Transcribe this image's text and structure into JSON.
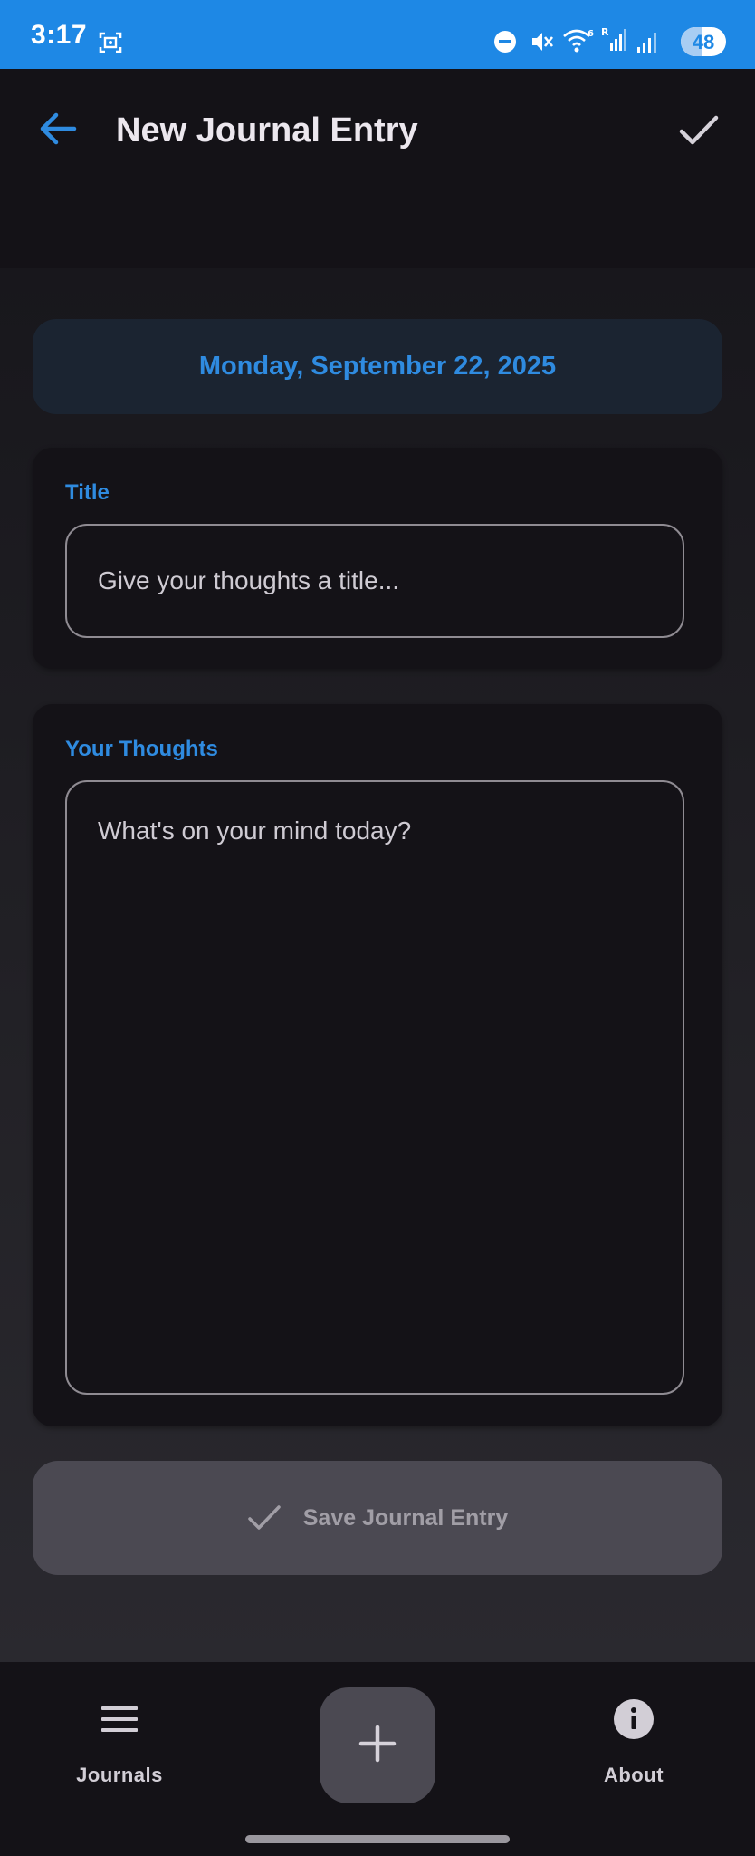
{
  "status_bar": {
    "time": "3:17",
    "battery_level": "48",
    "icons": [
      "screenshot-icon",
      "do-not-disturb-icon",
      "mute-icon",
      "wifi-icon",
      "signal-roaming-icon",
      "signal-icon",
      "battery-icon"
    ],
    "color": "#1e88e5"
  },
  "app_bar": {
    "title": "New Journal Entry",
    "back_icon": "arrow-left-icon",
    "confirm_icon": "check-icon"
  },
  "date_card": {
    "date": "Monday, September 22, 2025"
  },
  "title_field": {
    "label": "Title",
    "placeholder": "Give your thoughts a title...",
    "value": ""
  },
  "thoughts_field": {
    "label": "Your Thoughts",
    "placeholder": "What's on your mind today?",
    "value": ""
  },
  "save_button": {
    "label": "Save Journal Entry",
    "icon": "check-icon",
    "enabled": false
  },
  "bottom_nav": {
    "items": [
      {
        "label": "Journals",
        "icon": "menu-icon"
      },
      {
        "label": "About",
        "icon": "info-icon"
      }
    ],
    "fab_icon": "plus-icon"
  },
  "colors": {
    "accent": "#2f8be0",
    "background": "#141217",
    "surface": "#1b2431",
    "disabled_button": "#4b4952"
  }
}
